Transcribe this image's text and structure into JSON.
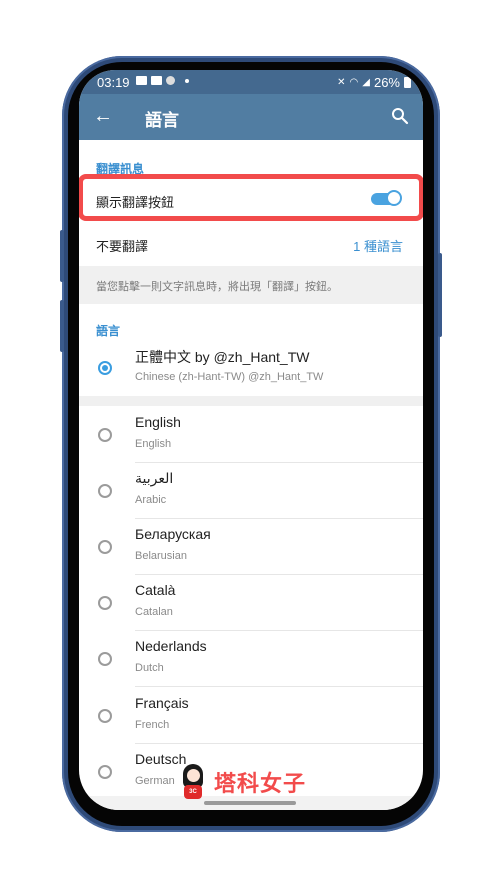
{
  "status_bar": {
    "time": "03:19",
    "battery": "26%",
    "icons": [
      "gallery-icon",
      "youtube-icon",
      "circle-icon",
      "dot-icon",
      "mute-icon",
      "wifi-icon",
      "signal-icon",
      "battery-icon"
    ]
  },
  "app_bar": {
    "back_icon": "←",
    "title": "語言",
    "search_icon": "search-icon"
  },
  "translate_section": {
    "header": "翻譯訊息",
    "show_translate_button_label": "顯示翻譯按鈕",
    "show_translate_button_on": true,
    "do_not_translate_label": "不要翻譯",
    "do_not_translate_value": "1 種語言",
    "info_text": "當您點擊一則文字訊息時，將出現「翻譯」按鈕。"
  },
  "language_section": {
    "header": "語言",
    "selected": {
      "name": "正體中文 by @zh_Hant_TW",
      "sub": "Chinese (zh-Hant-TW) @zh_Hant_TW",
      "checked": true
    },
    "items": [
      {
        "name": "English",
        "sub": "English"
      },
      {
        "name": "العربية",
        "sub": "Arabic"
      },
      {
        "name": "Беларуская",
        "sub": "Belarusian"
      },
      {
        "name": "Català",
        "sub": "Catalan"
      },
      {
        "name": "Nederlands",
        "sub": "Dutch"
      },
      {
        "name": "Français",
        "sub": "French"
      },
      {
        "name": "Deutsch",
        "sub": "German"
      }
    ]
  },
  "watermark": {
    "text": "塔科女子",
    "badge": "3C"
  },
  "colors": {
    "app_bar": "#517da2",
    "status_bar": "#44698f",
    "accent": "#3a8fd0",
    "highlight": "#f24b4b",
    "toggle": "#4aa3e0"
  }
}
